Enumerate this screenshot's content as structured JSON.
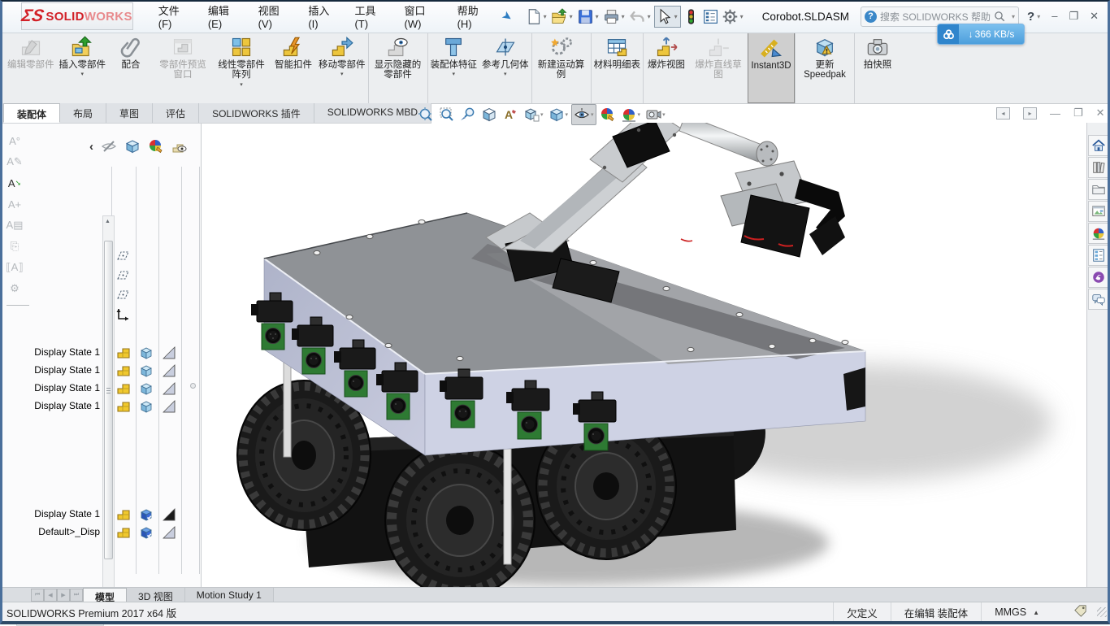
{
  "window": {
    "title": "Corobot.SLDASM",
    "brand": {
      "ds": "ΣS",
      "solid": "SOLID",
      "works": "WORKS"
    },
    "menu_items": [
      {
        "label": "文件(F)"
      },
      {
        "label": "编辑(E)"
      },
      {
        "label": "视图(V)"
      },
      {
        "label": "插入(I)"
      },
      {
        "label": "工具(T)"
      },
      {
        "label": "窗口(W)"
      },
      {
        "label": "帮助(H)"
      }
    ],
    "search_placeholder": "搜索 SOLIDWORKS 帮助",
    "help_label": "?",
    "controls": {
      "minimize": "–",
      "restore": "❐",
      "close": "✕"
    },
    "download_badge": {
      "arrow": "↓",
      "speed": "366 KB/s"
    }
  },
  "ribbon": {
    "buttons": [
      {
        "label": "编辑零部件",
        "icon": "edit-part",
        "state": "disabled"
      },
      {
        "label": "插入零部件",
        "icon": "insert-part",
        "caret": true
      },
      {
        "label": "配合",
        "icon": "mate"
      },
      {
        "label": "零部件预览窗口",
        "icon": "preview-window",
        "state": "disabled"
      },
      {
        "label": "线性零部件阵列",
        "icon": "linear-pattern",
        "caret": true
      },
      {
        "label": "智能扣件",
        "icon": "smart-fastener"
      },
      {
        "label": "移动零部件",
        "icon": "move-part",
        "caret": true
      },
      {
        "label": "显示隐藏的零部件",
        "icon": "show-hidden",
        "sep_before": true
      },
      {
        "label": "装配体特征",
        "icon": "assembly-feature",
        "caret": true,
        "sep_before": true
      },
      {
        "label": "参考几何体",
        "icon": "reference-geometry",
        "caret": true
      },
      {
        "label": "新建运动算例",
        "icon": "motion-study",
        "sep_before": true
      },
      {
        "label": "材料明细表",
        "icon": "bom",
        "sep_before": true
      },
      {
        "label": "爆炸视图",
        "icon": "exploded-view",
        "sep_before": true
      },
      {
        "label": "爆炸直线草图",
        "icon": "explode-sketch",
        "state": "disabled"
      },
      {
        "label": "Instant3D",
        "icon": "instant3d",
        "state": "active",
        "sep_before": true
      },
      {
        "label": "更新 Speedpak",
        "icon": "speedpak",
        "sep_before": true
      },
      {
        "label": "拍快照",
        "icon": "snapshot",
        "sep_before": true
      }
    ]
  },
  "command_tabs": {
    "items": [
      {
        "label": "装配体",
        "state": "active",
        "name": "tab-assembly"
      },
      {
        "label": "布局",
        "name": "tab-layout"
      },
      {
        "label": "草图",
        "name": "tab-sketch"
      },
      {
        "label": "评估",
        "name": "tab-evaluate"
      },
      {
        "label": "SOLIDWORKS 插件",
        "name": "tab-addins"
      },
      {
        "label": "SOLIDWORKS MBD",
        "name": "tab-mbd"
      }
    ]
  },
  "viewport_toolbar": {
    "items": [
      {
        "icon": "zoom-fit",
        "name": "zoom-to-fit-button"
      },
      {
        "icon": "zoom-area",
        "name": "zoom-to-area-button"
      },
      {
        "icon": "zoom-selection",
        "name": "zoom-to-selection-button"
      },
      {
        "icon": "section-view",
        "name": "section-view-button"
      },
      {
        "icon": "annotation-view",
        "name": "hide-show-annotations-button"
      },
      {
        "icon": "view-orientation",
        "name": "view-orientation-button",
        "caret": true
      },
      {
        "icon": "display-style",
        "name": "display-style-button",
        "caret": true
      },
      {
        "icon": "hide-show",
        "name": "hide-show-items-button",
        "caret": true,
        "state": "pressed"
      },
      {
        "icon": "edit-appearance",
        "name": "edit-appearance-button"
      },
      {
        "icon": "apply-scene",
        "name": "apply-scene-button",
        "caret": true
      },
      {
        "icon": "view-settings",
        "name": "view-settings-button",
        "caret": true
      }
    ]
  },
  "feature_panel": {
    "rows_top": [
      {
        "label": "Display State 1",
        "cube": "plain",
        "triangle": "light",
        "name": "component-row"
      },
      {
        "label": "Display State 1",
        "cube": "plain",
        "triangle": "light",
        "name": "component-row"
      },
      {
        "label": "Display State 1",
        "cube": "plain",
        "triangle": "light",
        "name": "component-row"
      },
      {
        "label": "Display State 1",
        "cube": "plain",
        "triangle": "light",
        "name": "component-row"
      }
    ],
    "rows_bottom": [
      {
        "label": "Display State 1",
        "cube": "checked",
        "triangle": "dark",
        "name": "component-row"
      },
      {
        "label": "Default>_Disp",
        "cube": "checked",
        "triangle": "light",
        "name": "component-row"
      }
    ]
  },
  "doc_tabs": {
    "items": [
      {
        "label": "模型",
        "state": "active",
        "name": "tab-model"
      },
      {
        "label": "3D 视图",
        "name": "tab-3d-views"
      },
      {
        "label": "Motion Study 1",
        "name": "tab-motion-study-1"
      }
    ]
  },
  "status_bar": {
    "app_version": "SOLIDWORKS Premium 2017 x64 版",
    "constraint_status": "欠定义",
    "edit_status": "在编辑 装配体",
    "units": "MMGS"
  },
  "colors": {
    "brand_red": "#d22027",
    "badge_blue": "#2f85cc",
    "body_lavender": "#c7cade",
    "accent_select": "#2d7dc2"
  }
}
